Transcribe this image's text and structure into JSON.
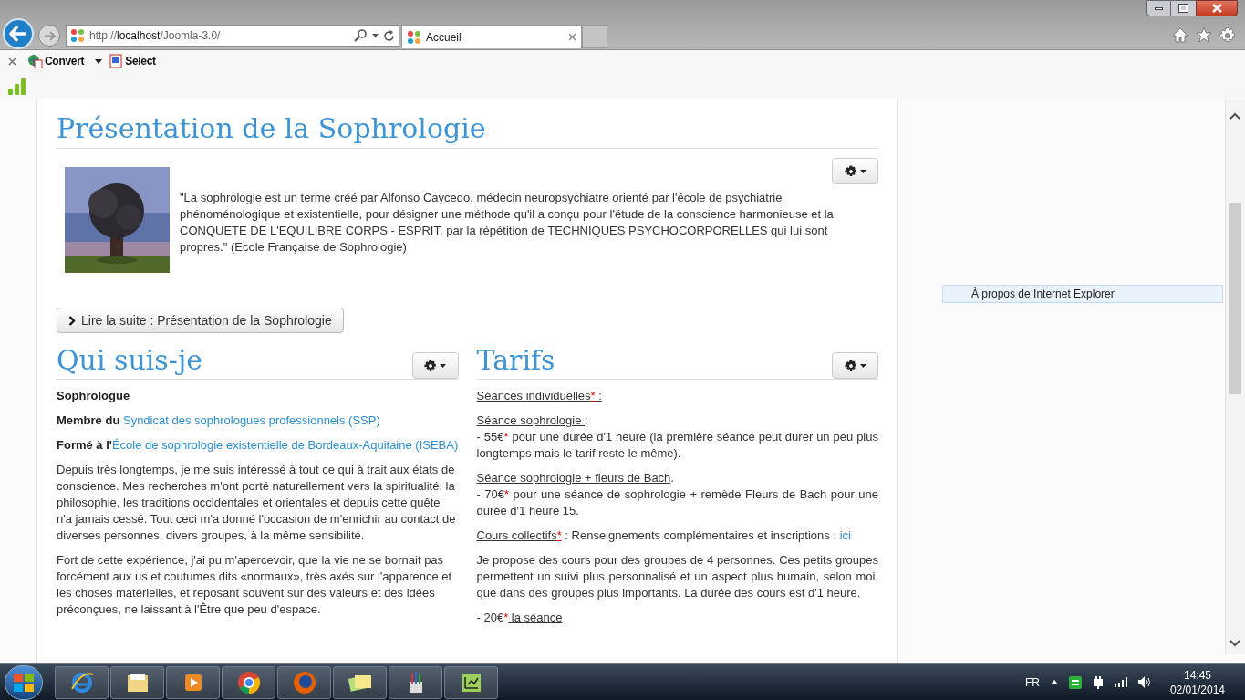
{
  "browser": {
    "address": [
      {
        "text": "http://",
        "kind": "dim"
      },
      {
        "text": "localhost",
        "kind": "host"
      },
      {
        "text": "/Joomla-3.0/",
        "kind": "dim"
      }
    ],
    "tabs": [
      {
        "label": "Accueil",
        "selected": true
      }
    ],
    "commands": [
      {
        "label": "Convert",
        "kind": "convert"
      },
      {
        "label": "Select",
        "kind": "select"
      }
    ],
    "menu_item": "À propos de Internet Explorer"
  },
  "article": {
    "title": "Présentation de la Sophrologie",
    "text": "\"La sophrologie est un terme créé par Alfonso Caycedo, médecin neuropsychiatre orienté par l'école de psychiatrie phénoménologique et existentielle, pour désigner une méthode qu'il a conçu pour l'étude de la conscience harmonieuse et la CONQUETE DE L'EQUILIBRE CORPS - ESPRIT, par la répétition de TECHNIQUES PSYCHOCORPORELLES qui lui sont propres.\" (Ecole Française de Sophrologie)",
    "read_more": "Lire la suite : Présentation de la Sophrologie"
  },
  "sections": [
    {
      "title": "Qui suis-je",
      "paragraphs": [
        {
          "lines": [
            [
              {
                "text": "Sophrologue",
                "kind": "bold"
              }
            ]
          ]
        },
        {
          "lines": [
            [
              {
                "text": "Membre du ",
                "kind": "bold"
              },
              {
                "text": "Syndicat des sophrologues professionnels (SSP)",
                "kind": "link"
              }
            ]
          ]
        },
        {
          "lines": [
            [
              {
                "text": "Formé à l'",
                "kind": "bold"
              },
              {
                "text": "École de sophrologie existentielle de Bordeaux-Aquitaine (ISEBA)",
                "kind": "link"
              }
            ]
          ]
        },
        {
          "lines": [
            [
              {
                "text": "Depuis très longtemps, je me suis intéressé à tout ce qui à trait aux états de conscience. Mes recherches m'ont porté naturellement vers la spiritualité, la philosophie, les traditions occidentales et orientales et depuis cette quête n'a jamais cessé. Tout ceci m'a donné l'occasion de m'enrichir au contact de diverses personnes, divers groupes, à la même sensibilité.",
                "kind": "plain"
              }
            ]
          ]
        },
        {
          "lines": [
            [
              {
                "text": "Fort de cette expérience, j'ai pu m'apercevoir, que la vie ne se bornait pas forcément aux us et coutumes dits «normaux», très axés sur l'apparence et les choses matérielles, et reposant souvent sur des valeurs et des idées préconçues, ne laissant à l'Être que peu d'espace.",
                "kind": "plain"
              }
            ]
          ]
        }
      ]
    },
    {
      "title": "Tarifs",
      "paragraphs": [
        {
          "lines": [
            [
              {
                "text": "Séances individuelles",
                "kind": "plain",
                "underline": true
              },
              {
                "text": "*",
                "kind": "star",
                "underline": true
              },
              {
                "text": " :",
                "kind": "plain",
                "underline": true
              }
            ]
          ]
        },
        {
          "lines": [
            [
              {
                "text": "Séance sophrologie ",
                "kind": "plain",
                "underline": true
              },
              {
                "text": ":",
                "kind": "plain"
              }
            ],
            [
              {
                "text": "- 55€",
                "kind": "plain"
              },
              {
                "text": "*",
                "kind": "star"
              },
              {
                "text": " pour une durée d'1 heure (la première séance peut durer un peu plus longtemps mais le tarif reste le même).",
                "kind": "plain"
              }
            ]
          ]
        },
        {
          "lines": [
            [
              {
                "text": "Séance sophrologie + fleurs de Bach",
                "kind": "plain",
                "underline": true
              },
              {
                "text": ".",
                "kind": "plain"
              }
            ],
            [
              {
                "text": "- 70€",
                "kind": "plain"
              },
              {
                "text": "*",
                "kind": "star"
              },
              {
                "text": " pour une séance de sophrologie + remède Fleurs de Bach pour une durée d'1 heure 15.",
                "kind": "plain"
              }
            ]
          ]
        },
        {
          "lines": [
            [
              {
                "text": "Cours collectifs",
                "kind": "plain",
                "underline": true
              },
              {
                "text": "*",
                "kind": "star",
                "underline": true
              },
              {
                "text": " : Renseignements complémentaires et inscriptions : ",
                "kind": "plain"
              },
              {
                "text": "ici",
                "kind": "link"
              }
            ]
          ]
        },
        {
          "lines": [
            [
              {
                "text": "Je propose des cours pour des groupes de 4 personnes. Ces petits groupes permettent un suivi plus personnalisé et un aspect plus humain, selon moi, que dans des groupes plus importants. La durée des cours est d'1 heure.",
                "kind": "plain"
              }
            ]
          ]
        },
        {
          "lines": [
            [
              {
                "text": "- 20€",
                "kind": "plain"
              },
              {
                "text": "*",
                "kind": "star"
              },
              {
                "text": " la séance",
                "kind": "plain",
                "underline": true
              }
            ]
          ]
        }
      ]
    }
  ],
  "taskbar": {
    "language": "FR",
    "time": "14:45",
    "date": "02/01/2014"
  }
}
